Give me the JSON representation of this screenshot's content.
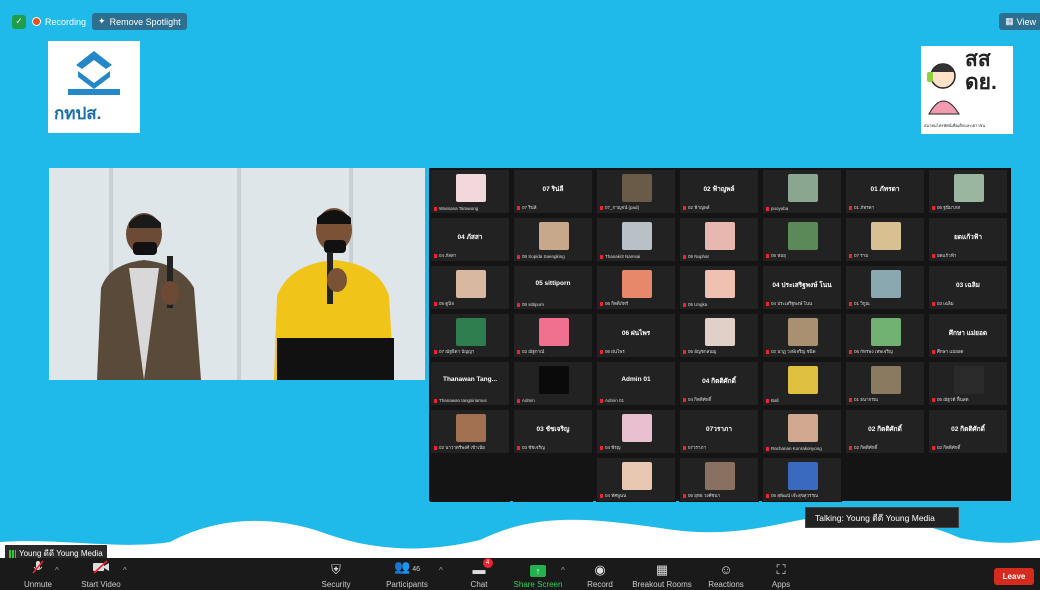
{
  "topbar": {
    "recording_label": "Recording",
    "spotlight_label": "Remove Spotlight",
    "view_label": "View"
  },
  "logos": {
    "left_text": "กทปส.",
    "right_text_line1": "สส",
    "right_text_line2": "ดย.",
    "right_small_text": "สมาคมโทรทัศน์เพื่อเด็กและเยาวชน"
  },
  "gallery": {
    "tiles": [
      {
        "name": "",
        "sub": "Wassana Tarawong",
        "pic": "#f2d7dc"
      },
      {
        "name": "07 ริน่ลี",
        "sub": "07 ริน่ลี",
        "pic": ""
      },
      {
        "name": "",
        "sub": "07_กาญจน์ (pad)",
        "pic": "#6a5a48"
      },
      {
        "name": "02 ฟ้าญพล์",
        "sub": "02 ฟ้าญพล์",
        "pic": ""
      },
      {
        "name": "",
        "sub": "pooyuba",
        "pic": "#8aa590"
      },
      {
        "name": "01 ภัทรดา",
        "sub": "01 ภัทรดา",
        "pic": ""
      },
      {
        "name": "",
        "sub": "05 ฐนีมาภส",
        "pic": "#9ab5a0"
      },
      {
        "name": "04 ภัสสา",
        "sub": "04 ภัสสา",
        "pic": ""
      },
      {
        "name": "",
        "sub": "05 Sopida Saengking",
        "pic": "#c8a88a"
      },
      {
        "name": "",
        "sub": "Thanakrit Namsai",
        "pic": "#b8c0c8"
      },
      {
        "name": "",
        "sub": "05 Nuphat",
        "pic": "#e8b8b0"
      },
      {
        "name": "",
        "sub": "05 หมยุ",
        "pic": "#5b8a58"
      },
      {
        "name": "",
        "sub": "07 ราม",
        "pic": "#d8c090"
      },
      {
        "name": "ยดแก้วฟ้า",
        "sub": "ยดแก้วฟ้า",
        "pic": ""
      },
      {
        "name": "",
        "sub": "05 ตูนิจ",
        "pic": "#d8b8a0"
      },
      {
        "name": "05 sittiporn",
        "sub": "05 sittiporn",
        "pic": ""
      },
      {
        "name": "",
        "sub": "06 กิตติภัทร์",
        "pic": "#e8886a"
      },
      {
        "name": "",
        "sub": "05 Ungka",
        "pic": "#f0c0b0"
      },
      {
        "name": "04 ประเสริฐพงษ์ โนน",
        "sub": "04 ประเสริฐพงษ์ โนน",
        "pic": ""
      },
      {
        "name": "",
        "sub": "01 วิกูณ",
        "pic": "#8aa8b0"
      },
      {
        "name": "03 เฉลิม",
        "sub": "03 เฉลิม",
        "pic": ""
      },
      {
        "name": "",
        "sub": "07 ณัฐธิดา ปัญญา",
        "pic": "#2e7d4f"
      },
      {
        "name": "",
        "sub": "02 ณัฐกาณ์",
        "pic": "#f07090"
      },
      {
        "name": "06 ฝนไพร",
        "sub": "06 ฝนไพร",
        "pic": ""
      },
      {
        "name": "",
        "sub": "05 อัญชกลนญ",
        "pic": "#e0d0c8"
      },
      {
        "name": "",
        "sub": "02 นาฏ วงษ์เจริญ ชนิด",
        "pic": "#a89070"
      },
      {
        "name": "",
        "sub": "06 กัทรพง เทพเจริญ",
        "pic": "#70b070"
      },
      {
        "name": "ศึกษา แม่ยอด",
        "sub": "ศึกษา แม่ยอด",
        "pic": ""
      },
      {
        "name": "Thanawan Tang...",
        "sub": "Thanawan tangsiriamus",
        "pic": ""
      },
      {
        "name": "",
        "sub": "Admin",
        "pic": "#0a0a0a"
      },
      {
        "name": "Admin 01",
        "sub": "Admin 01",
        "pic": ""
      },
      {
        "name": "04 กิตติศักดิ์",
        "sub": "04 กิตติศักดิ์",
        "pic": ""
      },
      {
        "name": "",
        "sub": "Ball",
        "pic": "#e0c040"
      },
      {
        "name": "",
        "sub": "01 ธนากรณ",
        "pic": "#8a7a60"
      },
      {
        "name": "",
        "sub": "05 ณัฐวดี ฟื้นสด",
        "pic": "#2a2a2a"
      },
      {
        "name": "",
        "sub": "02 นาวาตรีพงศ์ เข้าเนีย",
        "pic": "#a07050"
      },
      {
        "name": "03 ชัชเจริญ",
        "sub": "03 ชัชเจริญ",
        "pic": ""
      },
      {
        "name": "",
        "sub": "04 พีรญ",
        "pic": "#e8c0d0"
      },
      {
        "name": "07วราภา",
        "sub": "07วราภา",
        "pic": ""
      },
      {
        "name": "",
        "sub": "Rachanan Konrakonyong",
        "pic": "#d0a890"
      },
      {
        "name": "02 กิตติศักดิ์",
        "sub": "02 กิตติศักดิ์",
        "pic": ""
      },
      {
        "name": "02 กิตติศักดิ์",
        "sub": "02 กิตติศักดิ์",
        "pic": ""
      },
      {
        "name": "",
        "sub": "",
        "pic": ""
      },
      {
        "name": "",
        "sub": "",
        "pic": ""
      },
      {
        "name": "",
        "sub": "04 ทัศพูนน",
        "pic": "#e8c8b0"
      },
      {
        "name": "",
        "sub": "05 ยุทธ วงศ์ชนา",
        "pic": "#8a7060"
      },
      {
        "name": "",
        "sub": "05 สุพัฒน์ เจ๊ะสุขสุวรรณ",
        "pic": "#3a6ac0"
      }
    ]
  },
  "talking": "Talking:  Young ดีดี Young Media",
  "active_name": "Young ดีดี Young Media",
  "toolbar": {
    "unmute": "Unmute",
    "start_video": "Start Video",
    "security": "Security",
    "participants": "Participants",
    "participants_count": "46",
    "chat": "Chat",
    "chat_badge": "4",
    "share": "Share Screen",
    "record": "Record",
    "breakout": "Breakout Rooms",
    "reactions": "Reactions",
    "apps": "Apps",
    "leave": "Leave"
  }
}
